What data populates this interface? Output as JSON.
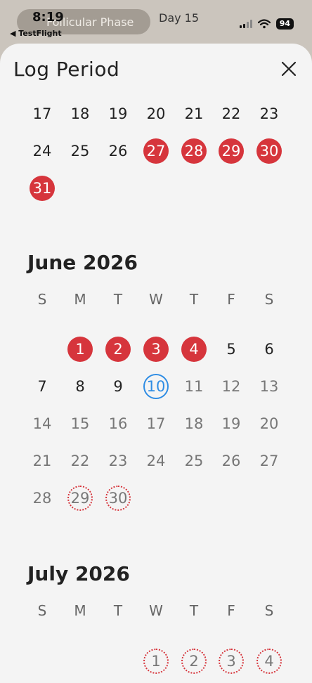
{
  "status": {
    "time": "8:19",
    "back_app": "◀ TestFlight",
    "phase": "Follicular Phase",
    "day": "Day 15",
    "battery": "94"
  },
  "sheet": {
    "title": "Log Period",
    "close_icon": "close-icon"
  },
  "weekdays": [
    "S",
    "M",
    "T",
    "W",
    "T",
    "F",
    "S"
  ],
  "may_tail": {
    "rows": [
      [
        {
          "d": "17"
        },
        {
          "d": "18"
        },
        {
          "d": "19"
        },
        {
          "d": "20"
        },
        {
          "d": "21"
        },
        {
          "d": "22"
        },
        {
          "d": "23"
        }
      ],
      [
        {
          "d": "24"
        },
        {
          "d": "25"
        },
        {
          "d": "26"
        },
        {
          "d": "27",
          "s": "period"
        },
        {
          "d": "28",
          "s": "period"
        },
        {
          "d": "29",
          "s": "period"
        },
        {
          "d": "30",
          "s": "period"
        }
      ],
      [
        {
          "d": "31",
          "s": "period"
        }
      ]
    ]
  },
  "june": {
    "title": "June 2026",
    "rows": [
      [
        null,
        {
          "d": "1",
          "s": "period"
        },
        {
          "d": "2",
          "s": "period"
        },
        {
          "d": "3",
          "s": "period"
        },
        {
          "d": "4",
          "s": "period"
        },
        {
          "d": "5"
        },
        {
          "d": "6"
        }
      ],
      [
        {
          "d": "7"
        },
        {
          "d": "8"
        },
        {
          "d": "9"
        },
        {
          "d": "10",
          "s": "today"
        },
        {
          "d": "11",
          "s": "future"
        },
        {
          "d": "12",
          "s": "future"
        },
        {
          "d": "13",
          "s": "future"
        }
      ],
      [
        {
          "d": "14",
          "s": "future"
        },
        {
          "d": "15",
          "s": "future"
        },
        {
          "d": "16",
          "s": "future"
        },
        {
          "d": "17",
          "s": "future"
        },
        {
          "d": "18",
          "s": "future"
        },
        {
          "d": "19",
          "s": "future"
        },
        {
          "d": "20",
          "s": "future"
        }
      ],
      [
        {
          "d": "21",
          "s": "future"
        },
        {
          "d": "22",
          "s": "future"
        },
        {
          "d": "23",
          "s": "future"
        },
        {
          "d": "24",
          "s": "future"
        },
        {
          "d": "25",
          "s": "future"
        },
        {
          "d": "26",
          "s": "future"
        },
        {
          "d": "27",
          "s": "future"
        }
      ],
      [
        {
          "d": "28",
          "s": "future"
        },
        {
          "d": "29",
          "s": "predicted"
        },
        {
          "d": "30",
          "s": "predicted"
        }
      ]
    ]
  },
  "july": {
    "title": "July 2026",
    "rows": [
      [
        null,
        null,
        null,
        {
          "d": "1",
          "s": "predicted"
        },
        {
          "d": "2",
          "s": "predicted"
        },
        {
          "d": "3",
          "s": "predicted"
        },
        {
          "d": "4",
          "s": "predicted"
        }
      ]
    ]
  },
  "colors": {
    "period": "#d6353c",
    "today": "#2f8de4",
    "sheet_bg": "#f4f4f4"
  }
}
